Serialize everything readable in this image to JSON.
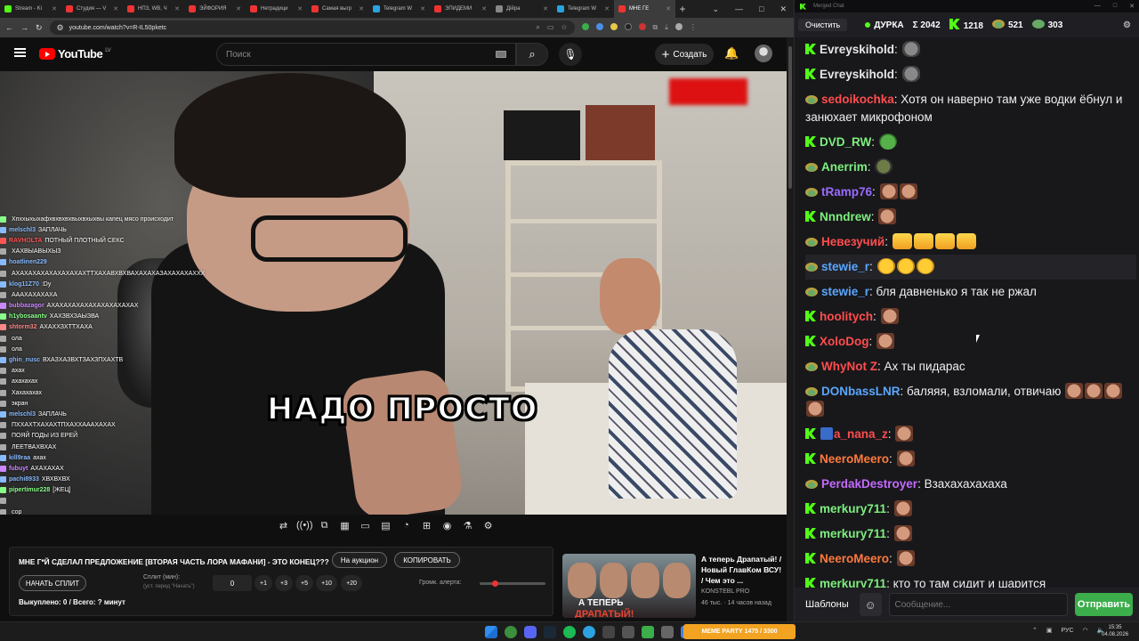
{
  "browser": {
    "tabs": [
      {
        "label": "Stream - Ki",
        "color": "#53fc18"
      },
      {
        "label": "Студия — V",
        "color": "#e33"
      },
      {
        "label": "НПЗ, WB, Ч",
        "color": "#e33"
      },
      {
        "label": "ЭЙФОРИЯ",
        "color": "#e33"
      },
      {
        "label": "Нетрадици",
        "color": "#e33"
      },
      {
        "label": "Самая выгр",
        "color": "#e33"
      },
      {
        "label": "Telegram W",
        "color": "#2aa3e0"
      },
      {
        "label": "ЭПИДЕМИ",
        "color": "#e33"
      },
      {
        "label": "Дiйра",
        "color": "#888"
      },
      {
        "label": "Telegram W",
        "color": "#2aa3e0"
      },
      {
        "label": "МНЕ ГЕ",
        "color": "#e33",
        "active": true
      }
    ],
    "new_tab": "+",
    "window_controls": [
      "⌄",
      "—",
      "□",
      "✕"
    ],
    "url": "youtube.com/watch?v=R-IL50pketc"
  },
  "youtube": {
    "logo_text": "YouTube",
    "region": "LV",
    "search_placeholder": "Поиск",
    "create_label": "Создать",
    "create_icon": "+"
  },
  "video": {
    "caption": "НАДО ПРОСТО",
    "overlay_chat": [
      {
        "name": "",
        "text": "Хпххыхыхафхвхвхвхвыхвхыхвы капец мясо происходит",
        "color": "#8f8"
      },
      {
        "name": "melschl3",
        "text": "ЗАПЛАЧЬ",
        "color": "#8bf"
      },
      {
        "name": "RAVHOLTA",
        "text": "ПОТНЫЙ ПЛОТНЫЙ СЕКС",
        "color": "#f55"
      },
      {
        "name": "",
        "text": "ХАХВЫАВЫХЫЗ",
        "color": "#aaa"
      },
      {
        "name": "hoatlinen229",
        "text": "",
        "color": "#8bf"
      },
      {
        "name": "",
        "text": "АХАХАХАХАХАХАХАХАХТТХАХАВХВХВАХАХАХАЗАХАХАХАХХХ",
        "color": "#aaa"
      },
      {
        "name": "klog11Z70",
        "text": ":Dy",
        "color": "#8bf"
      },
      {
        "name": "",
        "text": "АААХАХАХАХА",
        "color": "#aaa"
      },
      {
        "name": "bubbazagor",
        "text": "АХАХАХАХАХАХАХАХАХАХАХ",
        "color": "#c8f"
      },
      {
        "name": "h1ybosaantv",
        "text": "ХАХЗВХЗАЫЗВА",
        "color": "#8f8"
      },
      {
        "name": "shtorm32",
        "text": "АХАХХЗХТТХАХА",
        "color": "#f88"
      },
      {
        "name": "",
        "text": "ола",
        "color": "#aaa"
      },
      {
        "name": "",
        "text": "ола",
        "color": "#aaa"
      },
      {
        "name": "ghin_nusc",
        "text": "ВХАЗХАЗВХТЗАХЗПХАХТВ",
        "color": "#8bf"
      },
      {
        "name": "",
        "text": "ахах",
        "color": "#aaa"
      },
      {
        "name": "",
        "text": "ахахахах",
        "color": "#aaa"
      },
      {
        "name": "",
        "text": "Хахахахах",
        "color": "#aaa"
      },
      {
        "name": "",
        "text": "экран",
        "color": "#aaa"
      },
      {
        "name": "melschl3",
        "text": "ЗАПЛАЧЬ",
        "color": "#8bf"
      },
      {
        "name": "",
        "text": "ПХХАХТХАХАХТПХАХХАААХАХАХ",
        "color": "#aaa"
      },
      {
        "name": "",
        "text": "ПОЯЙ ГОДЫ ИЗ ЕРЕЙ",
        "color": "#aaa"
      },
      {
        "name": "",
        "text": "ЛЕЕТВАХВХАХ",
        "color": "#aaa"
      },
      {
        "name": "kill9raa",
        "text": "ахах",
        "color": "#8bf"
      },
      {
        "name": "fubuyt",
        "text": "АХАХАХАХ",
        "color": "#c8f"
      },
      {
        "name": "pachi8933",
        "text": "ХВХВХВХ",
        "color": "#8bf"
      },
      {
        "name": "pipertimur228",
        "text": "[ЖЕЦ]",
        "color": "#8f8"
      },
      {
        "name": "",
        "text": "",
        "color": "#aaa"
      },
      {
        "name": "",
        "text": "сор",
        "color": "#aaa"
      }
    ]
  },
  "player_controls": [
    "⇄",
    "((•))",
    "⧉",
    "▦",
    "▭",
    "▤",
    "◔",
    "⊞",
    "◉",
    "⚗",
    "⚙"
  ],
  "info_panel": {
    "title": "МНЕ Г*Й СДЕЛАЛ ПРЕДЛОЖЕНИЕ [ВТОРАЯ ЧАСТЬ ЛОРА МАФАНИ] - ЭТО КОНЕЦ???",
    "auction_label": "На аукцион",
    "copy_label": "КОПИРОВАТЬ",
    "start_split_label": "НАЧАТЬ СПЛИТ",
    "split_label": "Сплит (мин):",
    "split_sub": "(уст. перед \"Начать\")",
    "split_value": "0",
    "steps": [
      "+1",
      "+3",
      "+5",
      "+10",
      "+20"
    ],
    "volume_label": "Громк. алерта:",
    "volume_fraction": 0.0,
    "status": "Выкуплено: 0 / Всего: ? минут"
  },
  "recommended": {
    "thumb_text1": "А ТЕПЕРЬ",
    "thumb_text2": "ДРАПАТЫЙ!",
    "title": "А теперь Драпатый! / Новый ГлавКом ВСУ! / Чем это ...",
    "channel": "KONSTEBL PRO",
    "views": "46 тыс. · 14 часов назад"
  },
  "chat": {
    "window_title": "Merged Chat",
    "clear_label": "Очистить",
    "streamer": "ДУРКА",
    "total_label": "Σ 2042",
    "kick_count": "1218",
    "twitch_count": "521",
    "yt_count": "303",
    "messages": [
      {
        "platform": "kick",
        "user": "Evreyskihold",
        "color": "#e6e6e6",
        "text": ":",
        "emotes": [
          "gray"
        ]
      },
      {
        "platform": "kick",
        "user": "Evreyskihold",
        "color": "#e6e6e6",
        "text": ":",
        "emotes": [
          "gray"
        ]
      },
      {
        "platform": "twitch",
        "user": "sedoikochka",
        "color": "#ff4d4d",
        "text": ": Хотя он наверно там уже водки ёбнул и занюхает микрофоном",
        "emotes": []
      },
      {
        "platform": "kick",
        "user": "DVD_RW",
        "color": "#7ef07e",
        "text": ":",
        "emotes": [
          "frog"
        ]
      },
      {
        "platform": "twitch",
        "user": "Anerrim",
        "color": "#7ef07e",
        "text": ":",
        "emotes": [
          "frog2"
        ]
      },
      {
        "platform": "twitch",
        "user": "tRamp76",
        "color": "#9a6bff",
        "text": ":",
        "emotes": [
          "face",
          "face"
        ]
      },
      {
        "platform": "kick",
        "user": "Nnndrew",
        "color": "#7ef07e",
        "text": ":",
        "emotes": [
          "face"
        ]
      },
      {
        "platform": "twitch",
        "user": "Невезучий",
        "color": "#ff4d4d",
        "text": ":",
        "emotes": [
          "wide",
          "wide",
          "wide",
          "wide"
        ]
      },
      {
        "platform": "twitch",
        "user": "stewie_r",
        "color": "#5aa7ff",
        "text": ":",
        "emotes": [
          "laugh",
          "laugh",
          "laugh"
        ],
        "highlight": true
      },
      {
        "platform": "twitch",
        "user": "stewie_r",
        "color": "#5aa7ff",
        "text": ": бля давненько я так не ржал",
        "emotes": []
      },
      {
        "platform": "kick",
        "user": "hoolitych",
        "color": "#ff4d4d",
        "text": ":",
        "emotes": [
          "face"
        ]
      },
      {
        "platform": "kick",
        "user": "XoloDog",
        "color": "#ff4d4d",
        "text": ":",
        "emotes": [
          "face"
        ]
      },
      {
        "platform": "twitch",
        "user": "WhyNot Z",
        "color": "#ff4d4d",
        "text": ": Ах ты пидарас",
        "emotes": []
      },
      {
        "platform": "twitch",
        "user": "DONbassLNR",
        "color": "#5aa7ff",
        "text": ": баляяя, взломали, отвичаю",
        "emotes": [
          "face",
          "face",
          "face",
          "face"
        ]
      },
      {
        "platform": "kick",
        "user": "a_nana_z",
        "color": "#ff4d4d",
        "text": ":",
        "emotes": [
          "face"
        ],
        "badge": "blue"
      },
      {
        "platform": "kick",
        "user": "NeeroMeero",
        "color": "#ff7a3d",
        "text": ":",
        "emotes": [
          "face"
        ]
      },
      {
        "platform": "twitch",
        "user": "PerdakDestroyer",
        "color": "#c46bff",
        "text": ": Взахахахахаха",
        "emotes": []
      },
      {
        "platform": "kick",
        "user": "merkury711",
        "color": "#7ef07e",
        "text": ":",
        "emotes": [
          "face"
        ]
      },
      {
        "platform": "kick",
        "user": "merkury711",
        "color": "#7ef07e",
        "text": ":",
        "emotes": [
          "face"
        ]
      },
      {
        "platform": "kick",
        "user": "NeeroMeero",
        "color": "#ff7a3d",
        "text": ":",
        "emotes": [
          "face"
        ]
      },
      {
        "platform": "kick",
        "user": "merkury711",
        "color": "#7ef07e",
        "text": ": кто то там сидит и шарится",
        "emotes": []
      }
    ],
    "templates_label": "Шаблоны",
    "emoji_icon": "☺",
    "input_placeholder": "Сообщение...",
    "send_label": "Отправить"
  },
  "taskbar": {
    "widget_label": "MEME PARTY",
    "widget_sub": "1475 / 3300",
    "lang": "РУС",
    "time": "15:35",
    "date": "04.08.2026"
  },
  "colors": {
    "kick": "#53fc18",
    "youtube_red": "#ff0000",
    "send_green": "#3bad4b"
  }
}
